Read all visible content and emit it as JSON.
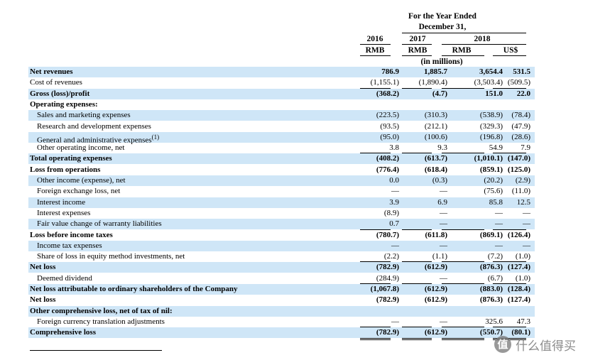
{
  "header": {
    "period": "For the Year Ended",
    "date": "December 31,",
    "years": [
      "2016",
      "2017",
      "2018"
    ],
    "currencies": [
      "RMB",
      "RMB",
      "RMB",
      "US$"
    ],
    "unit": "(in millions)"
  },
  "rows": [
    {
      "label": "Net revenues",
      "bold": true,
      "indent": false,
      "shade": true,
      "values": [
        "786.9",
        "1,885.7",
        "3,654.4",
        "531.5"
      ]
    },
    {
      "label": "Cost of revenues",
      "bold": false,
      "indent": false,
      "shade": false,
      "values": [
        "(1,155.1)",
        "(1,890.4)",
        "(3,503.4)",
        "(509.5)"
      ]
    },
    {
      "label": "Gross (loss)/profit",
      "bold": true,
      "indent": false,
      "shade": true,
      "values": [
        "(368.2)",
        "(4.7)",
        "151.0",
        "22.0"
      ]
    },
    {
      "label": "Operating expenses:",
      "bold": true,
      "indent": false,
      "shade": false,
      "values": [
        "",
        "",
        "",
        ""
      ]
    },
    {
      "label": "Sales and marketing expenses",
      "bold": false,
      "indent": true,
      "shade": true,
      "values": [
        "(223.5)",
        "(310.3)",
        "(538.9)",
        "(78.4)"
      ]
    },
    {
      "label": "Research and development expenses",
      "bold": false,
      "indent": true,
      "shade": false,
      "values": [
        "(93.5)",
        "(212.1)",
        "(329.3)",
        "(47.9)"
      ]
    },
    {
      "label": "General and administrative expenses",
      "sup": "(1)",
      "bold": false,
      "indent": true,
      "shade": true,
      "values": [
        "(95.0)",
        "(100.6)",
        "(196.8)",
        "(28.6)"
      ]
    },
    {
      "label": "Other operating income, net",
      "bold": false,
      "indent": true,
      "shade": false,
      "values": [
        "3.8",
        "9.3",
        "54.9",
        "7.9"
      ]
    },
    {
      "label": "Total operating expenses",
      "bold": true,
      "indent": false,
      "shade": true,
      "values": [
        "(408.2)",
        "(613.7)",
        "(1,010.1)",
        "(147.0)"
      ]
    },
    {
      "label": "Loss from operations",
      "bold": true,
      "indent": false,
      "shade": false,
      "values": [
        "(776.4)",
        "(618.4)",
        "(859.1)",
        "(125.0)"
      ]
    },
    {
      "label": "Other income (expense), net",
      "bold": false,
      "indent": true,
      "shade": true,
      "values": [
        "0.0",
        "(0.3)",
        "(20.2)",
        "(2.9)"
      ]
    },
    {
      "label": "Foreign exchange loss, net",
      "bold": false,
      "indent": true,
      "shade": false,
      "values": [
        "—",
        "—",
        "(75.6)",
        "(11.0)"
      ]
    },
    {
      "label": "Interest income",
      "bold": false,
      "indent": true,
      "shade": true,
      "values": [
        "3.9",
        "6.9",
        "85.8",
        "12.5"
      ]
    },
    {
      "label": "Interest expenses",
      "bold": false,
      "indent": true,
      "shade": false,
      "values": [
        "(8.9)",
        "—",
        "—",
        "—"
      ]
    },
    {
      "label": "Fair value change of warranty liabilities",
      "bold": false,
      "indent": true,
      "shade": true,
      "values": [
        "0.7",
        "—",
        "—",
        "—"
      ]
    },
    {
      "label": "Loss before income taxes",
      "bold": true,
      "indent": false,
      "shade": false,
      "values": [
        "(780.7)",
        "(611.8)",
        "(869.1)",
        "(126.4)"
      ]
    },
    {
      "label": "Income tax expenses",
      "bold": false,
      "indent": true,
      "shade": true,
      "values": [
        "—",
        "—",
        "—",
        "—"
      ]
    },
    {
      "label": "Share of loss in equity method investments, net",
      "bold": false,
      "indent": true,
      "shade": false,
      "values": [
        "(2.2)",
        "(1.1)",
        "(7.2)",
        "(1.0)"
      ]
    },
    {
      "label": "Net loss",
      "bold": true,
      "indent": false,
      "shade": true,
      "values": [
        "(782.9)",
        "(612.9)",
        "(876.3)",
        "(127.4)"
      ]
    },
    {
      "label": "Deemed dividend",
      "bold": false,
      "indent": true,
      "shade": false,
      "values": [
        "(284.9)",
        "—",
        "(6.7)",
        "(1.0)"
      ]
    },
    {
      "label": "Net loss attributable to ordinary shareholders of the Company",
      "bold": true,
      "indent": false,
      "shade": true,
      "values": [
        "(1,067.8)",
        "(612.9)",
        "(883.0)",
        "(128.4)"
      ]
    },
    {
      "label": "Net loss",
      "bold": true,
      "indent": false,
      "shade": false,
      "values": [
        "(782.9)",
        "(612.9)",
        "(876.3)",
        "(127.4)"
      ]
    },
    {
      "label": "Other comprehensive loss, net of tax of nil:",
      "bold": true,
      "indent": false,
      "shade": true,
      "values": [
        "",
        "",
        "",
        ""
      ]
    },
    {
      "label": "Foreign currency translation adjustments",
      "bold": false,
      "indent": true,
      "shade": false,
      "values": [
        "—",
        "—",
        "325.6",
        "47.3"
      ]
    },
    {
      "label": "Comprehensive loss",
      "bold": true,
      "indent": false,
      "shade": true,
      "values": [
        "(782.9)",
        "(612.9)",
        "(550.7)",
        "(80.1)"
      ]
    }
  ],
  "watermark": {
    "icon": "值",
    "text": "什么值得买"
  }
}
